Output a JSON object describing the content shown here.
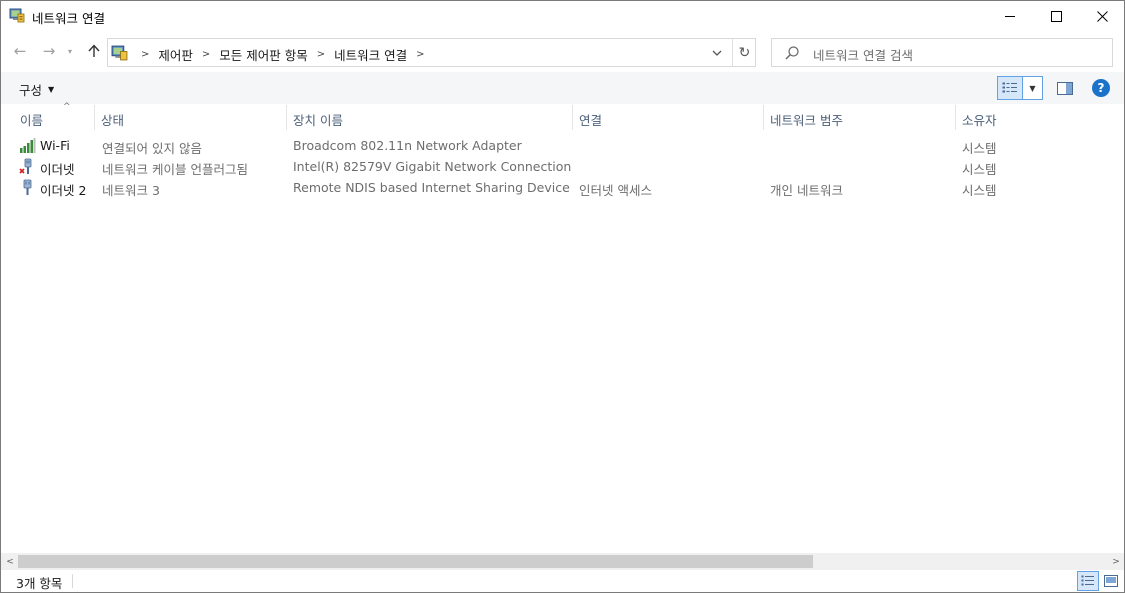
{
  "window": {
    "title": "네트워크 연결",
    "icon": "network-connections-icon"
  },
  "address": {
    "crumbs": [
      "제어판",
      "모든 제어판 항목",
      "네트워크 연결"
    ],
    "search_placeholder": "네트워크 연결 검색"
  },
  "toolbar": {
    "organize_label": "구성",
    "help_label": "?"
  },
  "columns": [
    "이름",
    "상태",
    "장치 이름",
    "연결",
    "네트워크 범주",
    "소유자"
  ],
  "items": [
    {
      "name": "Wi-Fi",
      "status": "연결되어 있지 않음",
      "device": "Broadcom 802.11n Network Adapter",
      "connectivity": "",
      "category": "",
      "owner": "시스템",
      "icon": "wifi-signal-icon"
    },
    {
      "name": "이더넷",
      "status": "네트워크 케이블 언플러그됨",
      "device": "Intel(R) 82579V Gigabit Network Connection",
      "connectivity": "",
      "category": "",
      "owner": "시스템",
      "icon": "ethernet-disconnected-icon"
    },
    {
      "name": "이더넷 2",
      "status": "네트워크 3",
      "device": "Remote NDIS based Internet Sharing Device",
      "connectivity": "인터넷 액세스",
      "category": "개인 네트워크",
      "owner": "시스템",
      "icon": "ethernet-icon"
    }
  ],
  "status": {
    "item_count": "3개 항목"
  },
  "colors": {
    "accent": "#1a73c8",
    "header_text": "#4c607a",
    "view_selected": "#d5e7f9"
  }
}
